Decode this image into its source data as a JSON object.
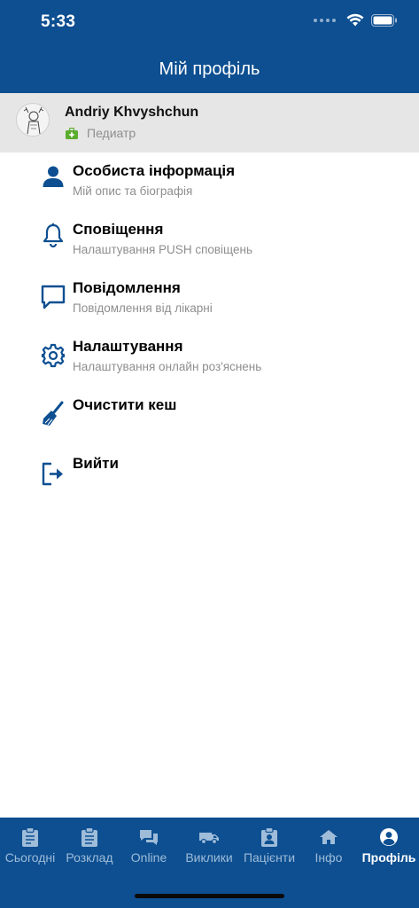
{
  "status_bar": {
    "time": "5:33"
  },
  "header": {
    "title": "Мій профіль"
  },
  "profile": {
    "name": "Andriy Khvyshchun",
    "role": "Педиатр"
  },
  "menu": [
    {
      "title": "Особиста інформація",
      "subtitle": "Мій опис та біографія",
      "icon": "person-icon"
    },
    {
      "title": "Сповіщення",
      "subtitle": "Налаштування PUSH сповіщень",
      "icon": "bell-icon"
    },
    {
      "title": "Повідомлення",
      "subtitle": "Повідомлення від лікарні",
      "icon": "message-icon"
    },
    {
      "title": "Налаштування",
      "subtitle": "Налаштування онлайн роз'яснень",
      "icon": "gear-icon"
    },
    {
      "title": "Очистити кеш",
      "subtitle": "",
      "icon": "broom-icon"
    },
    {
      "title": "Вийти",
      "subtitle": "",
      "icon": "logout-icon"
    }
  ],
  "tabs": [
    {
      "label": "Сьогодні",
      "icon": "clipboard-icon"
    },
    {
      "label": "Розклад",
      "icon": "clipboard-list-icon"
    },
    {
      "label": "Online",
      "icon": "chat-icon"
    },
    {
      "label": "Виклики",
      "icon": "ambulance-icon"
    },
    {
      "label": "Пацієнти",
      "icon": "patient-clipboard-icon"
    },
    {
      "label": "Інфо",
      "icon": "home-icon"
    },
    {
      "label": "Профіль",
      "icon": "user-circle-icon",
      "active": true
    }
  ],
  "colors": {
    "primary": "#0d4f91",
    "profile_bg": "#e6e6e6",
    "role_badge": "#5aad2e",
    "inactive_tab": "#9fbcd9"
  }
}
